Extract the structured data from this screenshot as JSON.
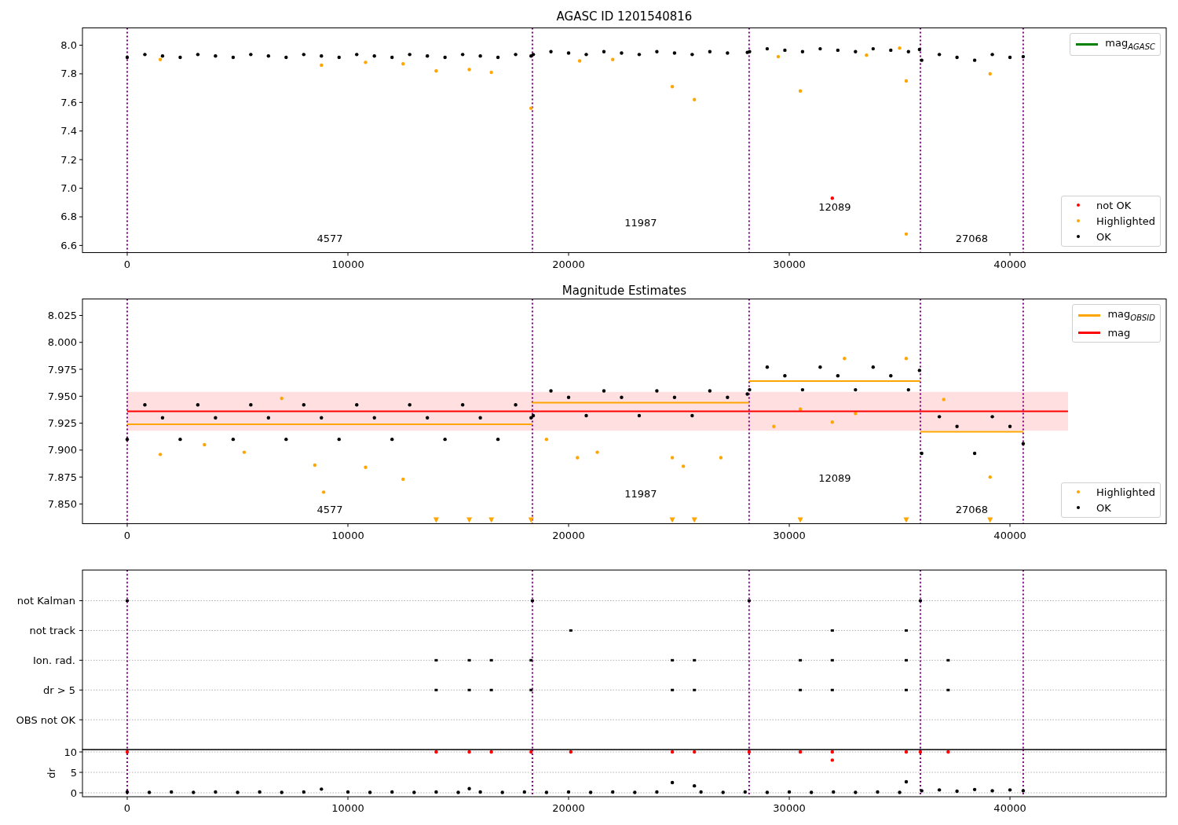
{
  "panels": [
    {
      "chart_data": {
        "type": "scatter",
        "title": "AGASC ID 1201540816",
        "xlim": [
          -2028,
          47080
        ],
        "ylim": [
          6.55,
          8.121
        ],
        "xticks": [
          {
            "value": 0,
            "label": "0"
          },
          {
            "value": 10000,
            "label": "10000"
          },
          {
            "value": 20000,
            "label": "20000"
          },
          {
            "value": 30000,
            "label": "30000"
          },
          {
            "value": 40000,
            "label": "40000"
          }
        ],
        "yticks": [
          {
            "value": 6.6,
            "label": "6.6"
          },
          {
            "value": 6.8,
            "label": "6.8"
          },
          {
            "value": 7.0,
            "label": "7.0"
          },
          {
            "value": 7.2,
            "label": "7.2"
          },
          {
            "value": 7.4,
            "label": "7.4"
          },
          {
            "value": 7.6,
            "label": "7.6"
          },
          {
            "value": 7.8,
            "label": "7.8"
          },
          {
            "value": 8.0,
            "label": "8.0"
          }
        ],
        "series": [
          {
            "color": "#000000",
            "x": [
              0,
              800,
              1600,
              2400,
              3200,
              4000,
              4800,
              5600,
              6400,
              7200,
              8000,
              8800,
              9600,
              10400,
              11200,
              12000,
              12800,
              13600,
              14400,
              15200,
              16000,
              16800,
              17600,
              18300,
              18400,
              19200,
              20000,
              20800,
              21600,
              22400,
              23200,
              24000,
              24800,
              25600,
              26400,
              27200,
              28100,
              28200,
              29000,
              29800,
              30600,
              31400,
              32200,
              33000,
              33800,
              34600,
              35400,
              35900,
              36000,
              36800,
              37600,
              38400,
              39200,
              40000,
              40600
            ],
            "values": [
              7.915,
              7.935,
              7.925,
              7.915,
              7.935,
              7.925,
              7.915,
              7.935,
              7.925,
              7.915,
              7.935,
              7.925,
              7.915,
              7.935,
              7.925,
              7.915,
              7.935,
              7.925,
              7.915,
              7.935,
              7.925,
              7.915,
              7.935,
              7.925,
              7.935,
              7.955,
              7.945,
              7.935,
              7.955,
              7.945,
              7.935,
              7.955,
              7.945,
              7.935,
              7.955,
              7.945,
              7.95,
              7.955,
              7.975,
              7.965,
              7.955,
              7.975,
              7.965,
              7.955,
              7.975,
              7.965,
              7.955,
              7.97,
              7.895,
              7.935,
              7.915,
              7.895,
              7.935,
              7.915,
              7.92
            ]
          },
          {
            "color": "#ffa500",
            "x": [
              14000,
              15500,
              16500,
              18300,
              24700,
              25700,
              30500,
              35300,
              35300,
              39100,
              8800,
              12500,
              10800,
              1500,
              20500,
              22000,
              29500,
              33500,
              35000
            ],
            "values": [
              7.82,
              7.83,
              7.81,
              7.56,
              7.71,
              7.62,
              7.68,
              7.75,
              6.68,
              7.8,
              7.86,
              7.87,
              7.88,
              7.9,
              7.89,
              7.9,
              7.92,
              7.93,
              7.98
            ]
          },
          {
            "color": "#ff0000",
            "x": [
              31950
            ],
            "values": [
              6.93
            ]
          }
        ],
        "ref_lines": [
          {
            "axis": "x",
            "value": 0,
            "color": "#800080"
          },
          {
            "axis": "x",
            "value": 18360,
            "color": "#800080"
          },
          {
            "axis": "x",
            "value": 28180,
            "color": "#800080"
          },
          {
            "axis": "x",
            "value": 35940,
            "color": "#800080"
          },
          {
            "axis": "x",
            "value": 40600,
            "color": "#800080"
          }
        ],
        "annotations": [
          "4577",
          "11987",
          "12089",
          "27068"
        ]
      },
      "legends": {
        "upper": [
          {
            "label": "mag$_{AGASC}$",
            "color": "#008000",
            "kind": "line"
          }
        ],
        "lower": [
          {
            "label": "not OK",
            "color": "#ff0000",
            "kind": "dot"
          },
          {
            "label": "Highlighted",
            "color": "#ffa500",
            "kind": "dot"
          },
          {
            "label": "OK",
            "color": "#000000",
            "kind": "dot"
          }
        ]
      }
    },
    {
      "chart_data": {
        "type": "scatter",
        "title": "Magnitude Estimates",
        "xlim": [
          -2028,
          47080
        ],
        "ylim": [
          7.8317,
          8.0403
        ],
        "xticks": [
          {
            "value": 0,
            "label": "0"
          },
          {
            "value": 10000,
            "label": "10000"
          },
          {
            "value": 20000,
            "label": "20000"
          },
          {
            "value": 30000,
            "label": "30000"
          },
          {
            "value": 40000,
            "label": "40000"
          }
        ],
        "yticks": [
          {
            "value": 7.85,
            "label": "7.850"
          },
          {
            "value": 7.875,
            "label": "7.875"
          },
          {
            "value": 7.9,
            "label": "7.900"
          },
          {
            "value": 7.925,
            "label": "7.925"
          },
          {
            "value": 7.95,
            "label": "7.950"
          },
          {
            "value": 7.975,
            "label": "7.975"
          },
          {
            "value": 8.0,
            "label": "8.000"
          },
          {
            "value": 8.025,
            "label": "8.025"
          }
        ],
        "bands": [
          {
            "axis": "y",
            "from": 7.918,
            "to": 7.954,
            "color": "#ffdfe0"
          }
        ],
        "series": [
          {
            "color": "#000000",
            "x": [
              0,
              800,
              1600,
              2400,
              3200,
              4000,
              4800,
              5600,
              6400,
              7200,
              8000,
              8800,
              9600,
              10400,
              11200,
              12000,
              12800,
              13600,
              14400,
              15200,
              16000,
              16800,
              17600,
              18300,
              18400,
              19200,
              20000,
              20800,
              21600,
              22400,
              23200,
              24000,
              24800,
              25600,
              26400,
              27200,
              28100,
              28200,
              29000,
              29800,
              30600,
              31400,
              32200,
              33000,
              33800,
              34600,
              35400,
              35900,
              36000,
              36800,
              37600,
              38400,
              39200,
              40000,
              40600
            ],
            "values": [
              7.91,
              7.942,
              7.93,
              7.91,
              7.942,
              7.93,
              7.91,
              7.942,
              7.93,
              7.91,
              7.942,
              7.93,
              7.91,
              7.942,
              7.93,
              7.91,
              7.942,
              7.93,
              7.91,
              7.942,
              7.93,
              7.91,
              7.942,
              7.93,
              7.932,
              7.955,
              7.949,
              7.932,
              7.955,
              7.949,
              7.932,
              7.955,
              7.949,
              7.932,
              7.955,
              7.949,
              7.952,
              7.956,
              7.977,
              7.969,
              7.956,
              7.977,
              7.969,
              7.956,
              7.977,
              7.969,
              7.956,
              7.974,
              7.897,
              7.931,
              7.922,
              7.897,
              7.931,
              7.922,
              7.906
            ]
          },
          {
            "color": "#ffa500",
            "x": [
              8500,
              8900,
              10800,
              12500,
              1500,
              20400,
              21300,
              24700,
              25200,
              26900,
              31950,
              39100,
              29300,
              30500,
              33000,
              5300,
              3500,
              19000,
              32500,
              35300,
              7000,
              37000,
              14000,
              15500,
              16500,
              18300,
              24700,
              25700,
              30500,
              35300,
              39100
            ],
            "values": [
              7.886,
              7.861,
              7.884,
              7.873,
              7.896,
              7.893,
              7.898,
              7.893,
              7.885,
              7.893,
              7.926,
              7.875,
              7.922,
              7.938,
              7.934,
              7.898,
              7.905,
              7.91,
              7.985,
              7.985,
              7.948,
              7.947,
              7.835,
              7.835,
              7.835,
              7.835,
              7.835,
              7.835,
              7.835,
              7.835,
              7.835
            ]
          },
          {
            "type": "line",
            "color": "#ffa500",
            "x": [
              0,
              18360
            ],
            "values": [
              7.924,
              7.924
            ]
          },
          {
            "type": "line",
            "color": "#ffa500",
            "x": [
              18360,
              28180
            ],
            "values": [
              7.944,
              7.944
            ]
          },
          {
            "type": "line",
            "color": "#ffa500",
            "x": [
              28180,
              35940
            ],
            "values": [
              7.964,
              7.964
            ]
          },
          {
            "type": "line",
            "color": "#ffa500",
            "x": [
              35940,
              40600
            ],
            "values": [
              7.917,
              7.917
            ]
          },
          {
            "type": "line",
            "color": "#ff0000",
            "x": [
              0,
              42630
            ],
            "values": [
              7.936,
              7.936
            ]
          }
        ],
        "ref_lines": [
          {
            "axis": "x",
            "value": 0,
            "color": "#800080"
          },
          {
            "axis": "x",
            "value": 18360,
            "color": "#800080"
          },
          {
            "axis": "x",
            "value": 28180,
            "color": "#800080"
          },
          {
            "axis": "x",
            "value": 35940,
            "color": "#800080"
          },
          {
            "axis": "x",
            "value": 40600,
            "color": "#800080"
          }
        ],
        "annotations": [
          "4577",
          "11987",
          "12089",
          "27068"
        ]
      },
      "legends": {
        "upper": [
          {
            "label": "mag$_{OBSID}$",
            "color": "#ffa500",
            "kind": "line"
          },
          {
            "label": "mag",
            "color": "#ff0000",
            "kind": "line"
          }
        ],
        "lower": [
          {
            "label": "Highlighted",
            "color": "#ffa500",
            "kind": "dot"
          },
          {
            "label": "OK",
            "color": "#000000",
            "kind": "dot"
          }
        ]
      }
    },
    {
      "chart_data": {
        "type": "scatter",
        "orientation": "horizontal",
        "grid": true,
        "xlim": [
          -2028,
          47080
        ],
        "categories": [
          "not Kalman",
          "not track",
          "Ion. rad.",
          "dr > 5",
          "OBS not OK"
        ],
        "series": [
          {
            "color": "#000000",
            "values": [
              0,
              20100,
              14000,
              14000,
              null
            ]
          },
          {
            "color": "#000000",
            "values": [
              18360,
              31950,
              15500,
              15500,
              null
            ]
          },
          {
            "color": "#000000",
            "values": [
              28180,
              35300,
              16500,
              16500,
              null
            ]
          },
          {
            "color": "#000000",
            "values": [
              35940,
              null,
              18300,
              18300,
              null
            ]
          },
          {
            "color": "#000000",
            "values": [
              null,
              null,
              24700,
              24700,
              null
            ]
          },
          {
            "color": "#000000",
            "values": [
              null,
              null,
              25700,
              25700,
              null
            ]
          },
          {
            "color": "#000000",
            "values": [
              null,
              null,
              30500,
              30500,
              null
            ]
          },
          {
            "color": "#000000",
            "values": [
              null,
              null,
              31950,
              31950,
              null
            ]
          },
          {
            "color": "#000000",
            "values": [
              null,
              null,
              35300,
              35300,
              null
            ]
          },
          {
            "color": "#000000",
            "values": [
              null,
              null,
              37200,
              37200,
              null
            ]
          }
        ],
        "ref_lines": [
          {
            "axis": "x",
            "value": 0,
            "color": "#800080"
          },
          {
            "axis": "x",
            "value": 18360,
            "color": "#800080"
          },
          {
            "axis": "x",
            "value": 28180,
            "color": "#800080"
          },
          {
            "axis": "x",
            "value": 35940,
            "color": "#800080"
          },
          {
            "axis": "x",
            "value": 40600,
            "color": "#800080"
          }
        ]
      }
    },
    {
      "chart_data": {
        "type": "scatter",
        "ylabel": "dr",
        "grid": true,
        "xlim": [
          -2028,
          47080
        ],
        "ylim": [
          -0.96,
          10.58
        ],
        "xticks": [
          {
            "value": 0,
            "label": "0"
          },
          {
            "value": 10000,
            "label": "10000"
          },
          {
            "value": 20000,
            "label": "20000"
          },
          {
            "value": 30000,
            "label": "30000"
          },
          {
            "value": 40000,
            "label": "40000"
          }
        ],
        "yticks": [
          {
            "value": 0,
            "label": "0"
          },
          {
            "value": 5,
            "label": "5"
          },
          {
            "value": 10,
            "label": "10"
          }
        ],
        "series": [
          {
            "color": "#000000",
            "x": [
              0,
              1000,
              2000,
              3000,
              4000,
              5000,
              6000,
              7000,
              8000,
              8800,
              10000,
              11000,
              12000,
              13000,
              14000,
              15000,
              15500,
              16000,
              17000,
              18000,
              19000,
              20000,
              21000,
              22000,
              23000,
              24000,
              24700,
              25700,
              26000,
              27000,
              28000,
              29000,
              30000,
              31000,
              32000,
              33000,
              34000,
              35000,
              35300,
              36000,
              36800,
              37600,
              38400,
              39200,
              40000,
              40600
            ],
            "values": [
              0.2,
              0.1,
              0.2,
              0.1,
              0.2,
              0.1,
              0.2,
              0.1,
              0.2,
              0.9,
              0.2,
              0.1,
              0.2,
              0.1,
              0.2,
              0.1,
              1.0,
              0.2,
              0.1,
              0.2,
              0.1,
              0.2,
              0.1,
              0.2,
              0.1,
              0.2,
              2.5,
              1.7,
              0.2,
              0.1,
              0.2,
              0.1,
              0.2,
              0.1,
              0.2,
              0.1,
              0.2,
              0.1,
              2.7,
              0.5,
              0.7,
              0.4,
              0.8,
              0.5,
              0.7,
              0.5
            ]
          },
          {
            "color": "#ff0000",
            "x": [
              0,
              14000,
              15500,
              16500,
              18300,
              20100,
              24700,
              25700,
              28180,
              30500,
              31950,
              35300,
              35940,
              37200,
              31950
            ],
            "values": [
              10,
              10,
              10,
              10,
              10,
              10,
              10,
              10,
              10,
              10,
              10,
              10,
              10,
              10,
              8
            ]
          }
        ],
        "ref_lines": [
          {
            "axis": "x",
            "value": 0,
            "color": "#800080"
          },
          {
            "axis": "x",
            "value": 18360,
            "color": "#800080"
          },
          {
            "axis": "x",
            "value": 28180,
            "color": "#800080"
          },
          {
            "axis": "x",
            "value": 35940,
            "color": "#800080"
          },
          {
            "axis": "x",
            "value": 40600,
            "color": "#800080"
          }
        ]
      }
    }
  ]
}
